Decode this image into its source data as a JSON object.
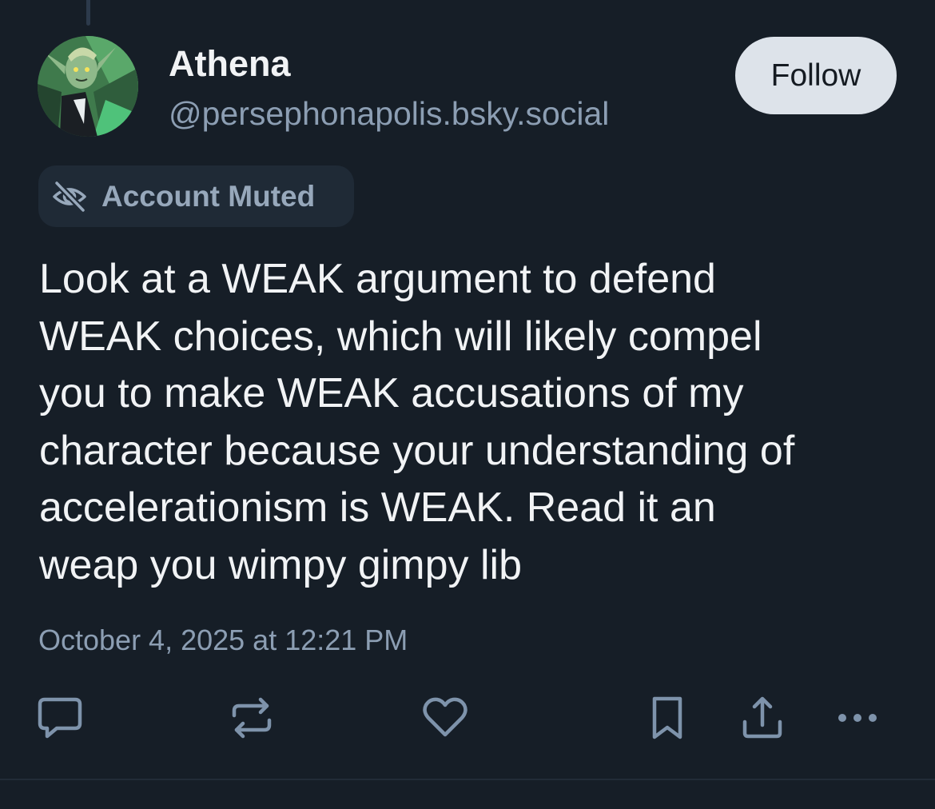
{
  "post": {
    "author": {
      "display_name": "Athena",
      "handle": "@persephonapolis.bsky.social"
    },
    "follow_label": "Follow",
    "moderation_label": "Account Muted",
    "text": "Look at a WEAK argument to defend\nWEAK choices, which will likely compel\nyou to make WEAK accusations of my\ncharacter because your understanding of\naccelerationism is WEAK. Read it an\nweap you wimpy gimpy lib",
    "timestamp": "October 4, 2025 at 12:21 PM"
  },
  "actions": [
    {
      "icon": "reply-icon"
    },
    {
      "icon": "repost-icon"
    },
    {
      "icon": "like-icon"
    },
    {
      "icon": "bookmark-icon"
    },
    {
      "icon": "share-icon"
    },
    {
      "icon": "more-options-icon"
    }
  ],
  "colors": {
    "background": "#161e27",
    "primary_text": "#f1f3f5",
    "secondary_text": "#8c9eb3",
    "follow_button_bg": "#dde3ea",
    "muted_pill_bg": "#1f2a36",
    "icon_color": "#7e93ab"
  }
}
